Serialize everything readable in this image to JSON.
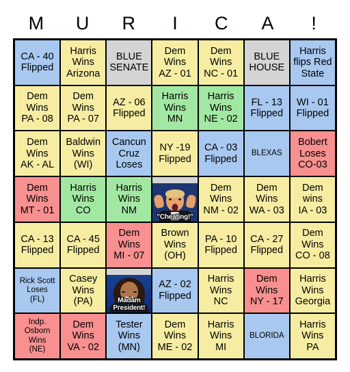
{
  "card": {
    "title": "MURICA Bingo Card",
    "header_letters": [
      "M",
      "U",
      "R",
      "I",
      "C",
      "A",
      "!"
    ],
    "colors": {
      "blue": "#a8c8f0",
      "yellow": "#f6eda2",
      "gray": "#d4d4d4",
      "green": "#a2e8a2",
      "red": "#f89090",
      "border": "#000000",
      "background": "#ffffff"
    },
    "columns": 7,
    "rows": 7,
    "cells": [
      [
        {
          "text": "CA - 40\nFlipped",
          "color": "blue",
          "size": "normal"
        },
        {
          "text": "Harris\nWins\nArizona",
          "color": "yellow",
          "size": "normal"
        },
        {
          "text": "BLUE\nSENATE",
          "color": "gray",
          "size": "normal"
        },
        {
          "text": "Dem\nWins\nAZ - 01",
          "color": "yellow",
          "size": "normal"
        },
        {
          "text": "Dem\nWins\nNC - 01",
          "color": "yellow",
          "size": "normal"
        },
        {
          "text": "BLUE\nHOUSE",
          "color": "gray",
          "size": "normal"
        },
        {
          "text": "Harris\nflips Red\nState",
          "color": "blue",
          "size": "normal"
        }
      ],
      [
        {
          "text": "Dem\nWins\nPA - 08",
          "color": "yellow",
          "size": "normal"
        },
        {
          "text": "Dem\nWins\nPA - 07",
          "color": "yellow",
          "size": "normal"
        },
        {
          "text": "AZ - 06\nFlipped",
          "color": "yellow",
          "size": "normal"
        },
        {
          "text": "Harris\nWins\nMN",
          "color": "green",
          "size": "normal"
        },
        {
          "text": "Harris\nWins\nNE - 02",
          "color": "green",
          "size": "normal"
        },
        {
          "text": "FL - 13\nFlipped",
          "color": "blue",
          "size": "normal"
        },
        {
          "text": "WI - 01\nFlipped",
          "color": "blue",
          "size": "normal"
        }
      ],
      [
        {
          "text": "Dem\nWins\nAK - AL",
          "color": "yellow",
          "size": "normal"
        },
        {
          "text": "Baldwin\nWins\n(WI)",
          "color": "yellow",
          "size": "normal"
        },
        {
          "text": "Cancun\nCruz\nLoses",
          "color": "blue",
          "size": "normal"
        },
        {
          "text": "NY -19\nFlipped",
          "color": "yellow",
          "size": "normal"
        },
        {
          "text": "CA - 03\nFlipped",
          "color": "blue",
          "size": "normal"
        },
        {
          "text": "BLEXAS",
          "color": "blue",
          "size": "small"
        },
        {
          "text": "Bobert\nLoses\nCO-03",
          "color": "red",
          "size": "normal"
        }
      ],
      [
        {
          "text": "Dem\nWins\nMT - 01",
          "color": "red",
          "size": "normal"
        },
        {
          "text": "Harris\nWins\nCO",
          "color": "green",
          "size": "normal"
        },
        {
          "text": "Harris\nWins\nNM",
          "color": "green",
          "size": "normal"
        },
        {
          "image": "trump-cheating",
          "caption": "\"Cheating!\"",
          "color": "gray",
          "size": "normal"
        },
        {
          "text": "Dem\nWins\nNM - 02",
          "color": "yellow",
          "size": "normal"
        },
        {
          "text": "Dem\nWins\nWA - 03",
          "color": "yellow",
          "size": "normal"
        },
        {
          "text": "Dem\nwins\nIA - 03",
          "color": "yellow",
          "size": "normal"
        }
      ],
      [
        {
          "text": "CA - 13\nFlipped",
          "color": "yellow",
          "size": "normal"
        },
        {
          "text": "CA - 45\nFlipped",
          "color": "yellow",
          "size": "normal"
        },
        {
          "text": "Dem\nWins\nMI - 07",
          "color": "red",
          "size": "normal"
        },
        {
          "text": "Brown\nWins\n(OH)",
          "color": "yellow",
          "size": "normal"
        },
        {
          "text": "PA - 10\nFlipped",
          "color": "yellow",
          "size": "normal"
        },
        {
          "text": "CA - 27\nFlipped",
          "color": "yellow",
          "size": "normal"
        },
        {
          "text": "Dem\nWins\nCO - 08",
          "color": "yellow",
          "size": "normal"
        }
      ],
      [
        {
          "text": "Rick Scott\nLoses\n(FL)",
          "color": "blue",
          "size": "small"
        },
        {
          "text": "Casey\nWins\n(PA)",
          "color": "yellow",
          "size": "normal"
        },
        {
          "image": "kamala-madam-president",
          "caption": "Madam\nPresident!",
          "color": "gray",
          "size": "normal"
        },
        {
          "text": "AZ - 02\nFlipped",
          "color": "blue",
          "size": "normal"
        },
        {
          "text": "Harris\nWins\nNC",
          "color": "yellow",
          "size": "normal"
        },
        {
          "text": "Dem\nWins\nNY - 17",
          "color": "red",
          "size": "normal"
        },
        {
          "text": "Harris\nWins\nGeorgia",
          "color": "yellow",
          "size": "normal"
        }
      ],
      [
        {
          "text": "Indp.\nOsborn\nWins\n(NE)",
          "color": "red",
          "size": "small"
        },
        {
          "text": "Dem\nWins\nVA - 02",
          "color": "red",
          "size": "normal"
        },
        {
          "text": "Tester\nWins\n(MN)",
          "color": "blue",
          "size": "normal"
        },
        {
          "text": "Dem\nWins\nME - 02",
          "color": "yellow",
          "size": "normal"
        },
        {
          "text": "Harris\nWins\nMI",
          "color": "yellow",
          "size": "normal"
        },
        {
          "text": "BLORIDA",
          "color": "blue",
          "size": "small"
        },
        {
          "text": "Harris\nWins\nPA",
          "color": "yellow",
          "size": "normal"
        }
      ]
    ]
  }
}
